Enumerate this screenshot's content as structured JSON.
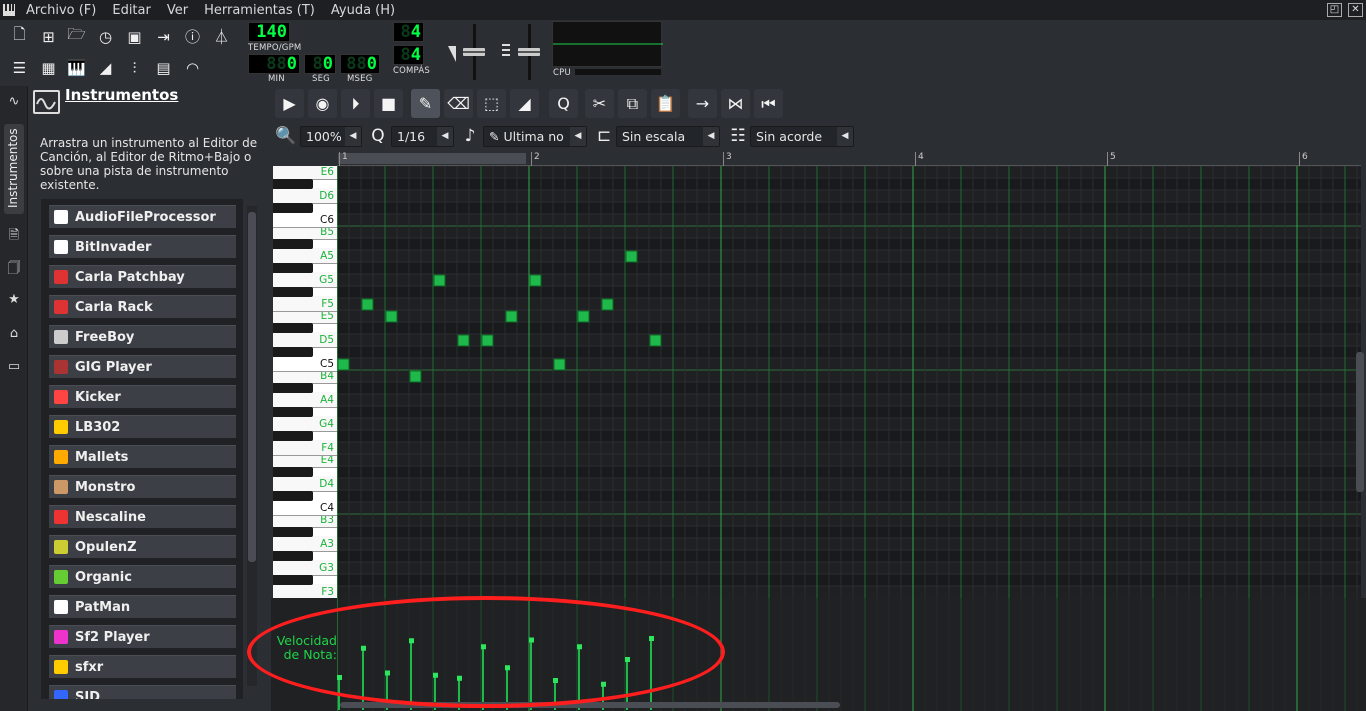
{
  "menubar": {
    "items": [
      "Archivo (F)",
      "Editar",
      "Ver",
      "Herramientas (T)",
      "Ayuda (H)"
    ]
  },
  "toolbar": {
    "tempo_value": "140",
    "tempo_label": "TEMPO/GPM",
    "time_min": "0",
    "time_sec": "0",
    "time_msec": "0",
    "label_min": "MIN",
    "label_seg": "SEG",
    "label_mseg": "MSEG",
    "compas_num": "4",
    "compas_den": "4",
    "compas_label": "COMPÁS",
    "cpu_label": "CPU"
  },
  "sidetabs": {
    "instrumentos": "Instrumentos"
  },
  "instruments_panel": {
    "title": "Instrumentos",
    "description": "Arrastra un instrumento al Editor de Canción, al Editor de Ritmo+Bajo o sobre una pista de instrumento existente.",
    "items": [
      {
        "label": "AudioFileProcessor",
        "icon": "note-icon",
        "color": "#ffffff"
      },
      {
        "label": "BitInvader",
        "icon": "bug-icon",
        "color": "#ffffff"
      },
      {
        "label": "Carla Patchbay",
        "icon": "carla-icon",
        "color": "#d33"
      },
      {
        "label": "Carla Rack",
        "icon": "carla-icon",
        "color": "#d33"
      },
      {
        "label": "FreeBoy",
        "icon": "gameboy-icon",
        "color": "#ccc"
      },
      {
        "label": "GIG Player",
        "icon": "gig-icon",
        "color": "#a33"
      },
      {
        "label": "Kicker",
        "icon": "kick-icon",
        "color": "#f44"
      },
      {
        "label": "LB302",
        "icon": "lb302-icon",
        "color": "#fc0"
      },
      {
        "label": "Mallets",
        "icon": "mallet-icon",
        "color": "#fa0"
      },
      {
        "label": "Monstro",
        "icon": "monstro-icon",
        "color": "#c96"
      },
      {
        "label": "Nescaline",
        "icon": "nes-icon",
        "color": "#e33"
      },
      {
        "label": "OpulenZ",
        "icon": "opulenz-icon",
        "color": "#cc3"
      },
      {
        "label": "Organic",
        "icon": "organic-icon",
        "color": "#6c3"
      },
      {
        "label": "PatMan",
        "icon": "patman-icon",
        "color": "#fff"
      },
      {
        "label": "Sf2 Player",
        "icon": "sf2-icon",
        "color": "#e3c"
      },
      {
        "label": "sfxr",
        "icon": "star-icon",
        "color": "#fc0"
      },
      {
        "label": "SID",
        "icon": "sid-icon",
        "color": "#36f"
      }
    ]
  },
  "piano_roll": {
    "zoom": "100%",
    "quantize": "1/16",
    "note_length": "Ultima no",
    "scale": "Sin escala",
    "chord": "Sin acorde",
    "timeline_ticks": [
      "1",
      "2",
      "3",
      "4",
      "5",
      "6"
    ],
    "key_labels": [
      "E6",
      "D6",
      "C6",
      "B5",
      "A5",
      "G5",
      "F5",
      "E5",
      "D5",
      "C5",
      "B4",
      "A4",
      "G4",
      "F4",
      "E4",
      "D4",
      "C4",
      "B3",
      "A3",
      "G3",
      "F3"
    ],
    "velocity_label_1": "Velocidad",
    "velocity_label_2": "de Nota:",
    "notes": [
      {
        "step": 0,
        "pitch": "C5",
        "velocity": 0.44
      },
      {
        "step": 1,
        "pitch": "F5",
        "velocity": 0.83
      },
      {
        "step": 2,
        "pitch": "E5",
        "velocity": 0.5
      },
      {
        "step": 3,
        "pitch": "B4",
        "velocity": 0.93
      },
      {
        "step": 4,
        "pitch": "G5",
        "velocity": 0.47
      },
      {
        "step": 5,
        "pitch": "D5",
        "velocity": 0.43
      },
      {
        "step": 6,
        "pitch": "D5",
        "velocity": 0.85
      },
      {
        "step": 7,
        "pitch": "E5",
        "velocity": 0.57
      },
      {
        "step": 8,
        "pitch": "G5",
        "velocity": 0.94
      },
      {
        "step": 9,
        "pitch": "C5",
        "velocity": 0.4
      },
      {
        "step": 10,
        "pitch": "E5",
        "velocity": 0.85
      },
      {
        "step": 11,
        "pitch": "F5",
        "velocity": 0.35
      },
      {
        "step": 12,
        "pitch": "A5",
        "velocity": 0.68
      },
      {
        "step": 13,
        "pitch": "D5",
        "velocity": 0.96
      }
    ]
  },
  "colors": {
    "note_green": "#1fb84a",
    "lcd_green": "#00ff44",
    "highlight_red": "#ff1e1e"
  }
}
